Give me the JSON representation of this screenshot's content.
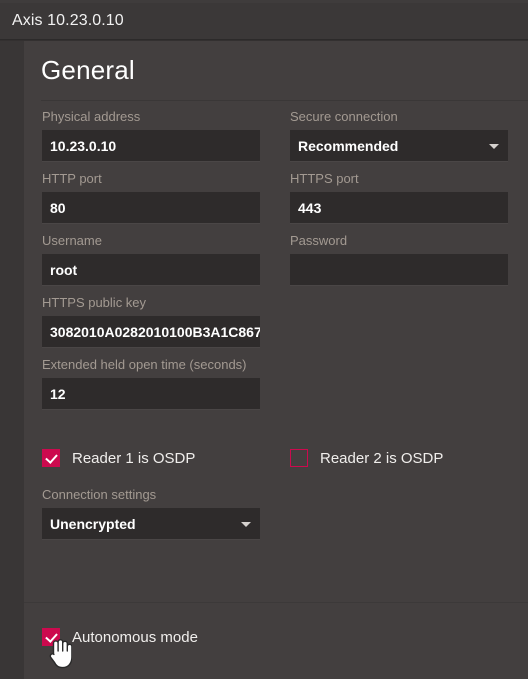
{
  "window": {
    "title": "Axis 10.23.0.10"
  },
  "panel": {
    "title": "General"
  },
  "form": {
    "rows": [
      {
        "left": {
          "label": "Physical address",
          "value": "10.23.0.10",
          "type": "text"
        },
        "right": {
          "label": "Secure connection",
          "value": "Recommended",
          "type": "select"
        }
      },
      {
        "left": {
          "label": "HTTP port",
          "value": "80",
          "type": "text"
        },
        "right": {
          "label": "HTTPS port",
          "value": "443",
          "type": "text"
        }
      },
      {
        "left": {
          "label": "Username",
          "value": "root",
          "type": "text"
        },
        "right": {
          "label": "Password",
          "value": "",
          "type": "password"
        }
      },
      {
        "left": {
          "label": "HTTPS public key",
          "value": "3082010A0282010100B3A1C867",
          "type": "text"
        },
        "right": null
      },
      {
        "left": {
          "label": "Extended held open time (seconds)",
          "value": "12",
          "type": "text"
        },
        "right": null
      }
    ]
  },
  "checkboxes": {
    "reader1": {
      "label": "Reader 1 is OSDP",
      "checked": true
    },
    "reader2": {
      "label": "Reader 2 is OSDP",
      "checked": false
    },
    "autonomous": {
      "label": "Autonomous mode",
      "checked": true
    }
  },
  "connection_settings": {
    "label": "Connection settings",
    "value": "Unencrypted"
  },
  "colors": {
    "accent": "#cc0a4e",
    "panel_bg": "#433f3f",
    "input_bg": "#2e2b2b",
    "label_text": "#a39a92",
    "titlebar_bg": "#3b3838"
  },
  "icons": {
    "select_caret": "chevron-down-icon",
    "check_mark": "check-icon",
    "pointer": "hand-pointer-cursor"
  }
}
